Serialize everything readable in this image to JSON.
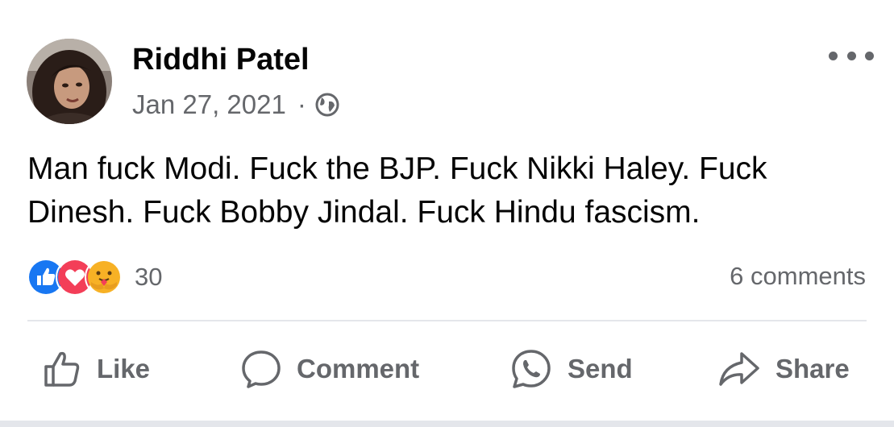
{
  "post": {
    "author": "Riddhi Patel",
    "date": "Jan 27, 2021",
    "separator": "·",
    "privacy_icon": "globe-icon",
    "text": "Man fuck Modi. Fuck the BJP. Fuck Nikki Haley. Fuck Dinesh. Fuck Bobby Jindal. Fuck Hindu fascism.",
    "reactions": {
      "icons": [
        "like-reaction-icon",
        "love-reaction-icon",
        "care-reaction-icon"
      ],
      "count": "30"
    },
    "comments_count": "6 comments"
  },
  "actions": {
    "like": "Like",
    "comment": "Comment",
    "send": "Send",
    "share": "Share"
  },
  "colors": {
    "text": "#050505",
    "secondary": "#65676b",
    "like_blue": "#1877f2",
    "love_red": "#f33e58",
    "care_yellow": "#f7b125",
    "divider": "#e4e6eb"
  }
}
